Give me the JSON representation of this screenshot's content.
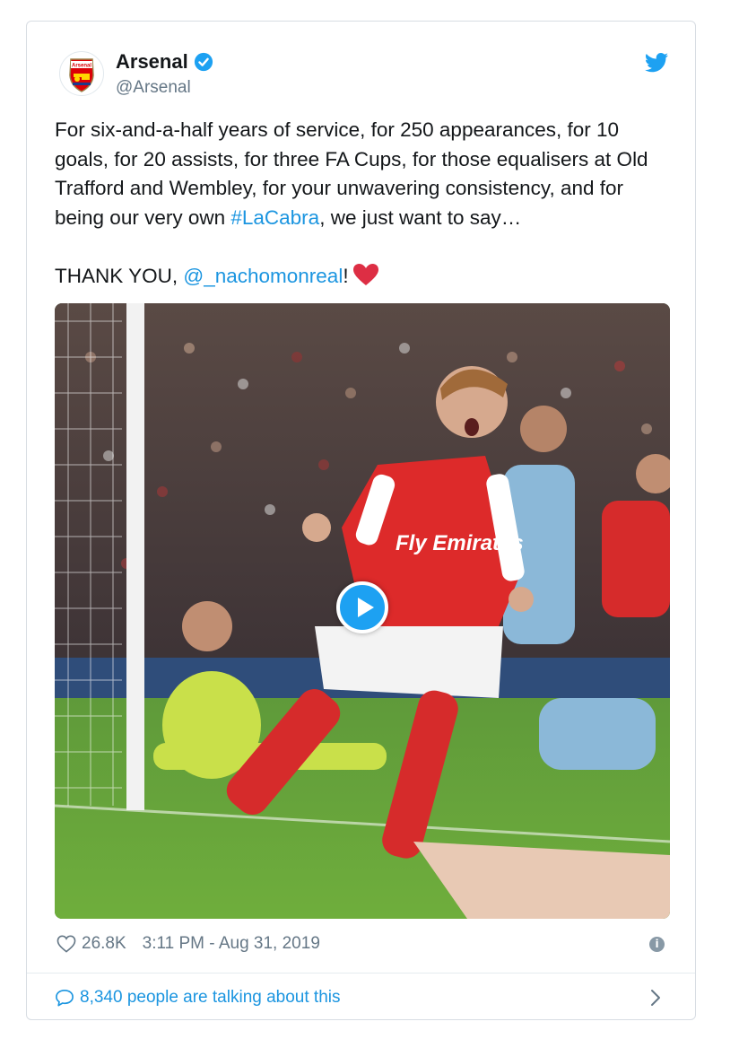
{
  "account": {
    "name": "Arsenal",
    "handle": "@Arsenal",
    "badge_text": "Arsenal",
    "verified": true
  },
  "tweet": {
    "text_before": "For six-and-a-half years of service, for 250 appearances, for 10 goals, for 20 assists, for three FA Cups, for those equalisers at Old Trafford and Wembley, for your unwavering consistency, and for being our very own ",
    "hashtag": "#LaCabra",
    "text_middle": ", we just want to say…\n\nTHANK YOU, ",
    "mention": "@_nachomonreal",
    "text_after": "!",
    "emoji": "heart"
  },
  "media": {
    "type": "video",
    "play_icon": "play-icon",
    "shirt_text": "Fly Emirates"
  },
  "footer": {
    "likes": "26.8K",
    "timestamp": "3:11 PM - Aug 31, 2019",
    "talking": "8,340 people are talking about this"
  },
  "colors": {
    "link": "#1b95e0",
    "twitter_blue": "#1da1f2",
    "heart_red": "#e0245e",
    "secondary_text": "#657786"
  }
}
